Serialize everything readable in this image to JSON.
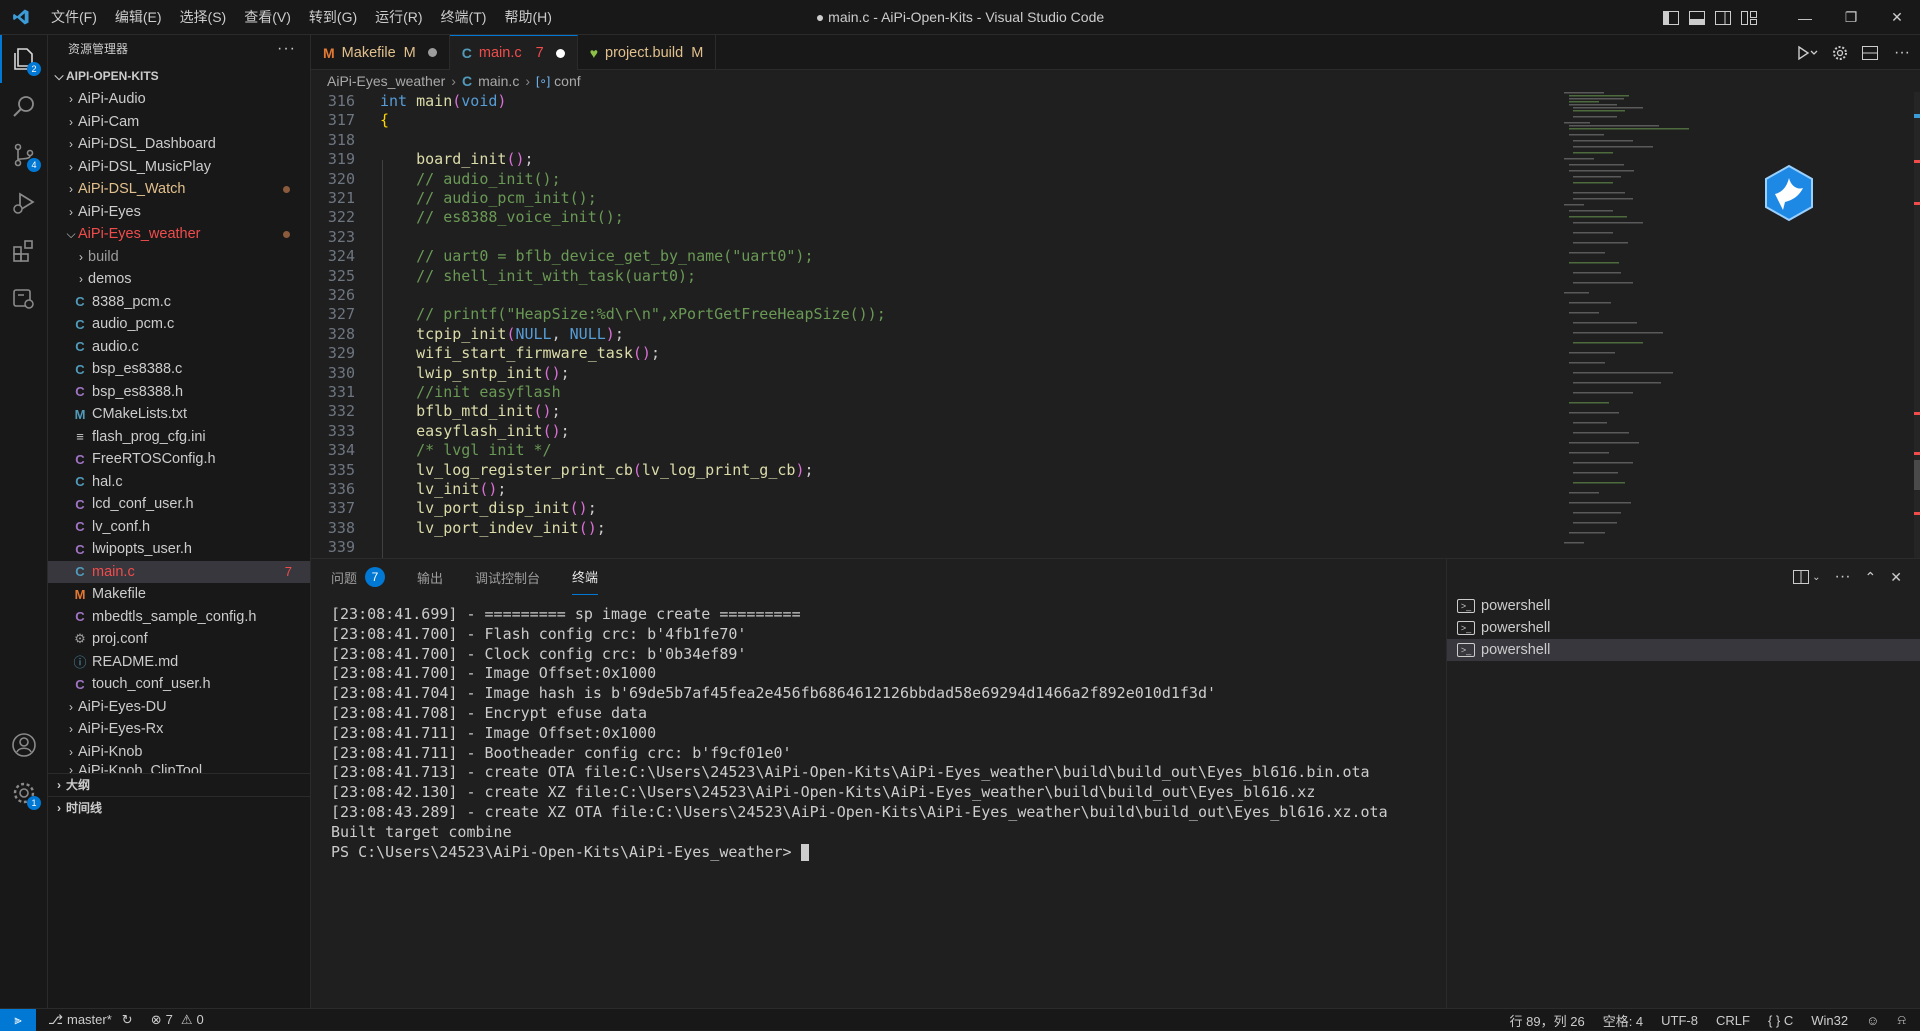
{
  "titlebar": {
    "menu": [
      "文件(F)",
      "编辑(E)",
      "选择(S)",
      "查看(V)",
      "转到(G)",
      "运行(R)",
      "终端(T)",
      "帮助(H)"
    ],
    "window_title": "● main.c - AiPi-Open-Kits - Visual Studio Code"
  },
  "activity": {
    "explorer_badge": "2",
    "scm_badge": "4",
    "settings_badge": "1"
  },
  "sidebar": {
    "title": "资源管理器",
    "root": "AIPI-OPEN-KITS",
    "items": [
      {
        "label": "AiPi-Audio"
      },
      {
        "label": "AiPi-Cam"
      },
      {
        "label": "AiPi-DSL_Dashboard"
      },
      {
        "label": "AiPi-DSL_MusicPlay"
      },
      {
        "label": "AiPi-DSL_Watch"
      },
      {
        "label": "AiPi-Eyes"
      },
      {
        "label": "AiPi-Eyes_weather"
      },
      {
        "label": "build"
      },
      {
        "label": "demos"
      },
      {
        "label": "8388_pcm.c"
      },
      {
        "label": "audio_pcm.c"
      },
      {
        "label": "audio.c"
      },
      {
        "label": "bsp_es8388.c"
      },
      {
        "label": "bsp_es8388.h"
      },
      {
        "label": "CMakeLists.txt"
      },
      {
        "label": "flash_prog_cfg.ini"
      },
      {
        "label": "FreeRTOSConfig.h"
      },
      {
        "label": "hal.c"
      },
      {
        "label": "lcd_conf_user.h"
      },
      {
        "label": "lv_conf.h"
      },
      {
        "label": "lwipopts_user.h"
      },
      {
        "label": "main.c",
        "problems": "7"
      },
      {
        "label": "Makefile"
      },
      {
        "label": "mbedtls_sample_config.h"
      },
      {
        "label": "proj.conf"
      },
      {
        "label": "README.md"
      },
      {
        "label": "touch_conf_user.h"
      },
      {
        "label": "AiPi-Eyes-DU"
      },
      {
        "label": "AiPi-Eyes-Rx"
      },
      {
        "label": "AiPi-Knob"
      },
      {
        "label": "AiPi-Knob_ClipTool"
      }
    ],
    "outline": "大纲",
    "timeline": "时间线"
  },
  "tabs": [
    {
      "icon": "M",
      "label": "Makefile",
      "status": "M"
    },
    {
      "icon": "C",
      "label": "main.c",
      "status": "7"
    },
    {
      "icon": "♥",
      "label": "project.build",
      "status": "M"
    }
  ],
  "breadcrumb": {
    "folder": "AiPi-Eyes_weather",
    "file": "main.c",
    "symbol": "conf"
  },
  "code": {
    "lines": [
      "316",
      "317",
      "318",
      "319",
      "320",
      "321",
      "322",
      "323",
      "324",
      "325",
      "326",
      "327",
      "328",
      "329",
      "330",
      "331",
      "332",
      "333",
      "334",
      "335",
      "336",
      "337",
      "338",
      "339"
    ]
  },
  "panel": {
    "tabs": [
      "问题",
      "输出",
      "调试控制台",
      "终端"
    ],
    "problems_count": "7",
    "terminal_lines": [
      "[23:08:41.699] - ========= sp image create =========",
      "[23:08:41.700] - Flash config crc: b'4fb1fe70'",
      "[23:08:41.700] - Clock config crc: b'0b34ef89'",
      "[23:08:41.700] - Image Offset:0x1000",
      "[23:08:41.704] - Image hash is b'69de5b7af45fea2e456fb6864612126bbdad58e69294d1466a2f892e010d1f3d'",
      "[23:08:41.708] - Encrypt efuse data",
      "[23:08:41.711] - Image Offset:0x1000",
      "[23:08:41.711] - Bootheader config crc: b'f9cf01e0'",
      "[23:08:41.713] - create OTA file:C:\\Users\\24523\\AiPi-Open-Kits\\AiPi-Eyes_weather\\build\\build_out\\Eyes_bl616.bin.ota",
      "[23:08:42.130] - create XZ file:C:\\Users\\24523\\AiPi-Open-Kits\\AiPi-Eyes_weather\\build\\build_out\\Eyes_bl616.xz",
      "[23:08:43.289] - create XZ OTA file:C:\\Users\\24523\\AiPi-Open-Kits\\AiPi-Eyes_weather\\build\\build_out\\Eyes_bl616.xz.ota",
      "Built target combine"
    ],
    "prompt": "PS C:\\Users\\24523\\AiPi-Open-Kits\\AiPi-Eyes_weather> ",
    "terminals": [
      "powershell",
      "powershell",
      "powershell"
    ]
  },
  "status": {
    "branch": "master*",
    "errors": "7",
    "warnings": "0",
    "position": "行 89，列 26",
    "spaces": "空格: 4",
    "encoding": "UTF-8",
    "eol": "CRLF",
    "language": "{ } C",
    "platform": "Win32"
  },
  "colors": {
    "accent": "#0078d4",
    "modified": "#e2c08d",
    "error": "#f14c4c",
    "keyword": "#569cd6",
    "function": "#dcdcaa",
    "comment": "#6a9955"
  }
}
